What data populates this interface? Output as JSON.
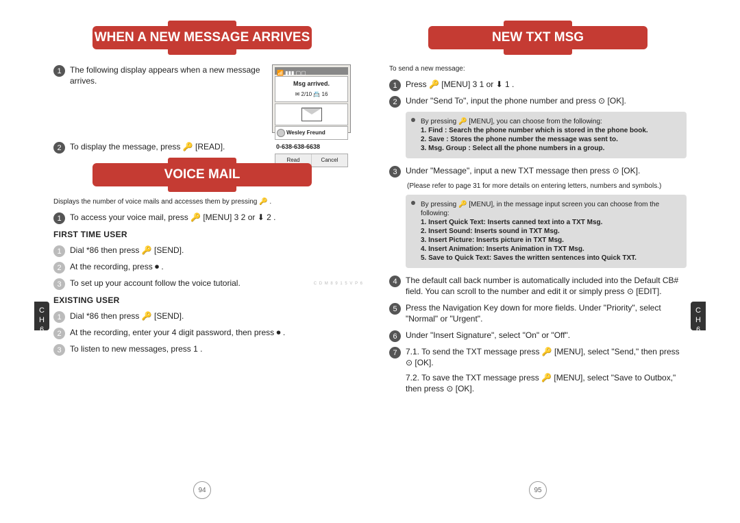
{
  "left_page": {
    "header1": "WHEN A NEW MESSAGE ARRIVES",
    "step1": "The following display appears when a new message arrives.",
    "phone": {
      "topbar": "📶 ▮▮▮ ▢▢",
      "title_line": "Msg arrived.",
      "counts": "✉ 2/10   📇 16",
      "from": "Wesley Freund",
      "number": "0-638-638-6638",
      "sk_left": "Read",
      "sk_right": "Cancel"
    },
    "step2": "To display the message, press 🔑 [READ].",
    "header2": "VOICE MAIL",
    "vm_intro": "Displays the number of voice mails and accesses them by pressing 🔑 .",
    "vm_step1": "To access your voice mail, press 🔑 [MENU] 3 2 or ⬇ 2 .",
    "sub_first": "FIRST TIME USER",
    "f1": "Dial *86 then press 🔑 [SEND].",
    "f2": "At the recording, press ⏺ .",
    "f3": "To set up your account follow the voice tutorial.",
    "sub_exist": "EXISTING USER",
    "e1": "Dial *86 then press 🔑 [SEND].",
    "e2": "At the recording, enter your 4 digit password, then press ⏺ .",
    "e3": "To listen to new messages, press 1 .",
    "pagenum": "94",
    "ch": "C\nH",
    "chnum": "6",
    "sidecode": "C D M 8 9 1 5 V P 6"
  },
  "right_page": {
    "header": "NEW TXT MSG",
    "intro": "To send a new message:",
    "s1": "Press 🔑 [MENU] 3 1 or ⬇ 1 .",
    "s2": "Under \"Send To\", input the phone number and press ⊙ [OK].",
    "box1": {
      "lead": "By pressing 🔑 [MENU], you can choose from the following:",
      "i1": "1. Find : Search the phone number which is stored in the phone book.",
      "i2": "2. Save : Stores the phone number the message was sent to.",
      "i3": "3. Msg. Group : Select all the phone numbers in a group."
    },
    "s3": "Under \"Message\", input a new TXT message then press ⊙ [OK].",
    "s3note": "(Please refer to page 31 for more details on entering letters, numbers and symbols.)",
    "box2": {
      "lead": "By pressing 🔑 [MENU], in the message input screen you can choose from the following:",
      "i1": "1. Insert Quick Text: Inserts canned text into a TXT Msg.",
      "i2": "2. Insert Sound: Inserts sound in TXT Msg.",
      "i3": "3. Insert Picture: Inserts picture in TXT Msg.",
      "i4": "4. Insert Animation: Inserts Animation in TXT Msg.",
      "i5": "5. Save to Quick Text: Saves the written sentences into Quick TXT."
    },
    "s4": "The default call back number is automatically included into the Default CB# field. You can scroll to the number and edit it or simply press ⊙ [EDIT].",
    "s5": "Press the Navigation Key down for more fields. Under \"Priority\", select \"Normal\" or \"Urgent\".",
    "s6": "Under \"Insert Signature\", select \"On\" or \"Off\".",
    "s7a": "7.1. To send the TXT message press 🔑 [MENU], select \"Send,\" then press ⊙ [OK].",
    "s7b": "7.2. To save the TXT message press 🔑 [MENU], select \"Save to Outbox,\" then press ⊙ [OK].",
    "pagenum": "95",
    "ch": "C\nH",
    "chnum": "6"
  }
}
